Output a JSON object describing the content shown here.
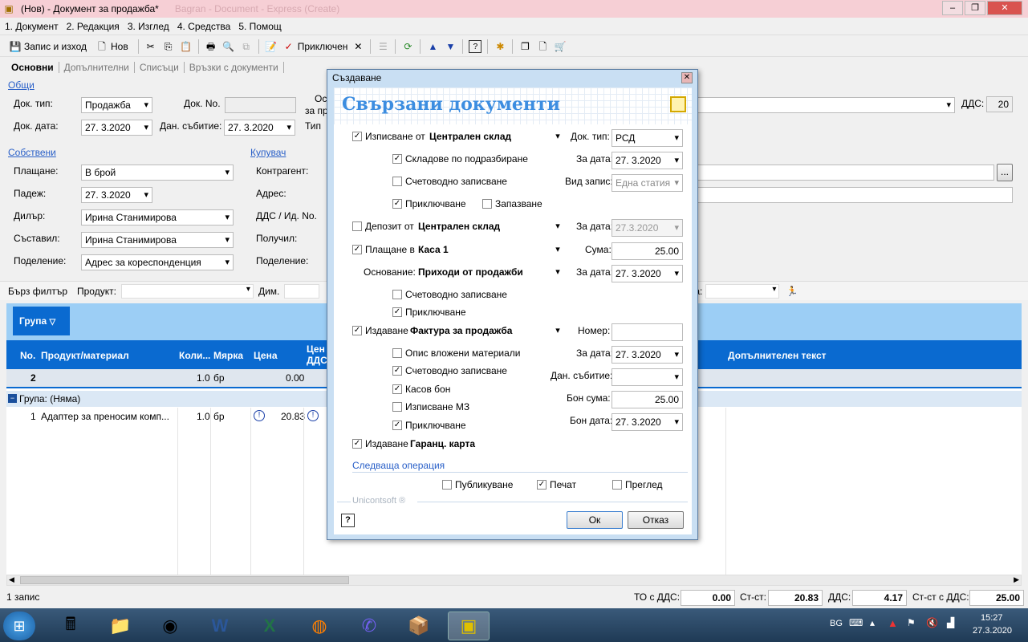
{
  "window": {
    "title": "(Нов) - Документ за продажба*",
    "title_ghost": "Bagran - Document - Express (Create)"
  },
  "menu": [
    "1. Документ",
    "2. Редакция",
    "3. Изглед",
    "4. Средства",
    "5. Помощ"
  ],
  "toolbar": {
    "save_exit": "Запис и изход",
    "new": "Нов",
    "close": "Приключен"
  },
  "tabs": [
    "Основни",
    "Допълнителни",
    "Списъци",
    "Връзки с документи"
  ],
  "general": {
    "section": "Общи",
    "doc_type_label": "Док. тип:",
    "doc_type": "Продажба",
    "doc_no_label": "Док. No.",
    "doc_date_label": "Док. дата:",
    "doc_date": "27.  3.2020",
    "tax_event_label": "Дан. събитие:",
    "tax_event": "27.  3.2020",
    "basis_label": "Ос",
    "basis_label2": "за пр",
    "type_label": "Тип",
    "vat_label": "ДДС:",
    "vat_value": "20"
  },
  "own": {
    "section": "Собствени",
    "payment_label": "Плащане:",
    "payment": "В брой",
    "due_label": "Падеж:",
    "due": "27.  3.2020",
    "dealer_label": "Дилър:",
    "dealer": "Ирина Станимирова",
    "author_label": "Съставил:",
    "author": "Ирина Станимирова",
    "division_label": "Поделение:",
    "division": "Адрес за кореспонденция"
  },
  "buyer": {
    "section": "Купувач",
    "counterparty_label": "Контрагент:",
    "address_label": "Адрес:",
    "vat_id_label": "ДДС / Ид. No.",
    "receiver_label": "Получил:",
    "division_label": "Поделение:"
  },
  "filter": {
    "quick": "Бърз филтър",
    "product": "Продукт:",
    "dim": "Дим.",
    "a_label": "а:"
  },
  "grid": {
    "group_btn": "Група",
    "columns": [
      "No.",
      "Продукт/материал",
      "Коли...",
      "Мярка",
      "Цена",
      "Цен ДДС",
      "Допълнителен текст"
    ],
    "total": {
      "no": "2",
      "qty": "1.0",
      "unit": "бр",
      "price": "0.00"
    },
    "group_row": "Група: (Няма)",
    "rows": [
      {
        "no": "1",
        "product": "Адаптер за преносим комп...",
        "qty": "1.0",
        "unit": "бр",
        "price": "20.83"
      }
    ]
  },
  "status": {
    "records": "1 запис",
    "to_vat_label": "ТО с ДДС:",
    "to_vat": "0.00",
    "cost_label": "Ст-ст:",
    "cost": "20.83",
    "vat_label": "ДДС:",
    "vat": "4.17",
    "cost_vat_label": "Ст-ст с ДДС:",
    "cost_vat": "25.00"
  },
  "taskbar": {
    "lang": "BG",
    "time": "15:27",
    "date": "27.3.2020"
  },
  "dialog": {
    "title": "Създаване",
    "header": "Свързани документи",
    "issue_from_label": "Изписване от",
    "issue_from": "Централен склад",
    "doc_type_label": "Док. тип:",
    "doc_type": "РСД",
    "default_stores": "Складове по подразбиране",
    "for_date_label": "За дата:",
    "date1": "27.  3.2020",
    "accounting": "Счетоводно записване",
    "record_type_label": "Вид запис:",
    "record_type": "Една статия",
    "closing": "Приключване",
    "saving": "Запазване",
    "deposit_label": "Депозит от",
    "deposit_from": "Централен склад",
    "deposit_date": "27.3.2020",
    "payment_label": "Плащане в",
    "payment_to": "Каса 1",
    "sum_label": "Сума:",
    "sum": "25.00",
    "basis_label": "Основание:",
    "basis": "Приходи от продажби",
    "date2": "27.  3.2020",
    "accounting2": "Счетоводно записване",
    "closing2": "Приключване",
    "issue_doc_label": "Издаване",
    "issue_doc": "Фактура за продажба",
    "number_label": "Номер:",
    "materials_list": "Опис вложени материали",
    "date3": "27.  3.2020",
    "accounting3": "Счетоводно записване",
    "tax_event_label": "Дан. събитие:",
    "cash_receipt": "Касов бон",
    "receipt_sum_label": "Бон сума:",
    "receipt_sum": "25.00",
    "issue_mz": "Изписване МЗ",
    "receipt_date_label": "Бон дата:",
    "receipt_date": "27.  3.2020",
    "closing3": "Приключване",
    "warranty_label": "Издаване",
    "warranty": "Гаранц. карта",
    "next_op": "Следваща операция",
    "publish": "Публикуване",
    "print": "Печат",
    "preview": "Преглед",
    "brand": "Unicontsoft ®",
    "ok": "Ок",
    "cancel": "Отказ"
  }
}
